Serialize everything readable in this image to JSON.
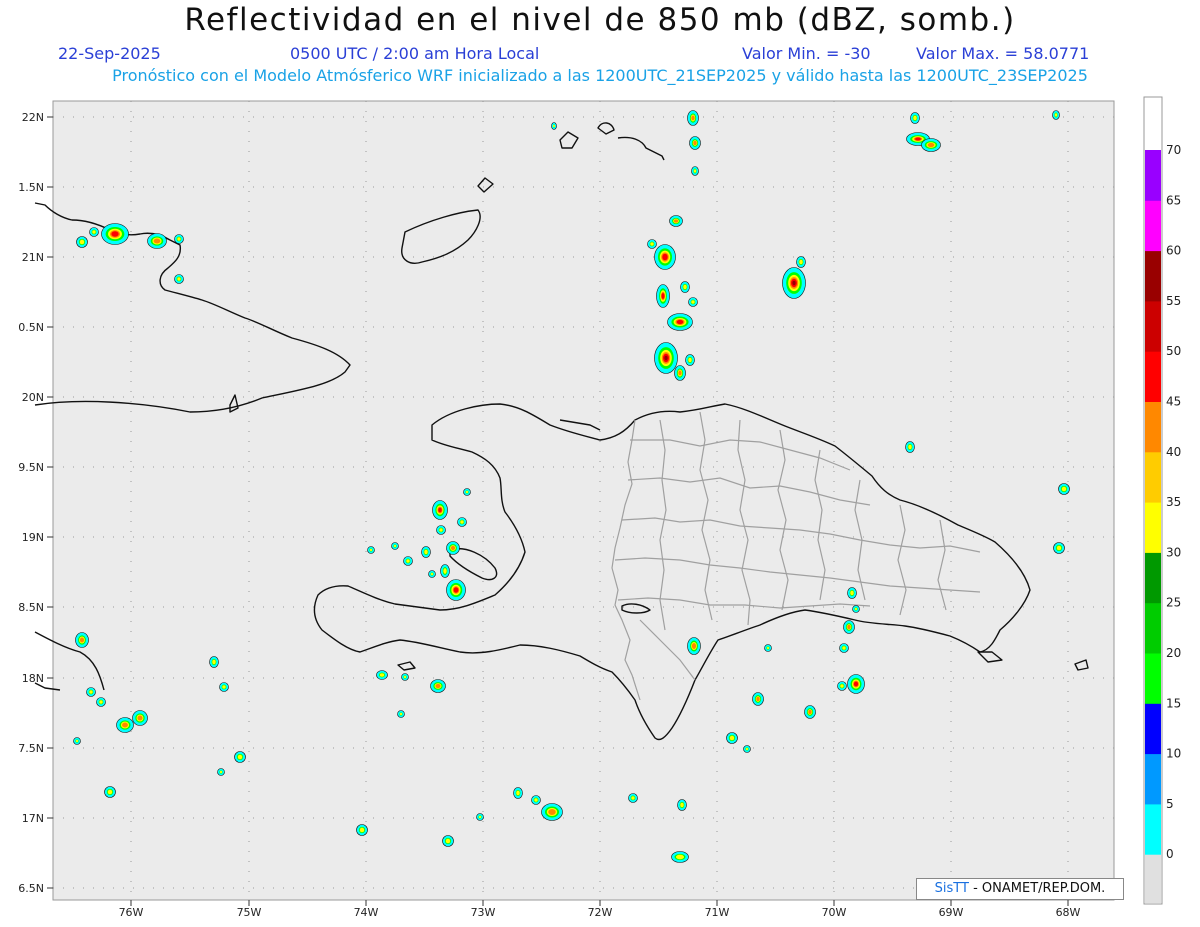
{
  "header": {
    "title": "Reflectividad en el nivel de 850 mb (dBZ, somb.)",
    "date": "22-Sep-2025",
    "time": "0500 UTC / 2:00 am Hora Local",
    "valmin": "Valor Min. = -30",
    "valmax": "Valor Max. = 58.0771",
    "subtitle": "Pronóstico con el Modelo Atmósferico WRF inicializado a las 1200UTC_21SEP2025 y válido hasta las  1200UTC_23SEP2025"
  },
  "axes": {
    "lat_labels": [
      "22N",
      "1.5N",
      "21N",
      "0.5N",
      "20N",
      "9.5N",
      "19N",
      "8.5N",
      "18N",
      "7.5N",
      "17N",
      "6.5N"
    ],
    "lon_labels": [
      "76W",
      "75W",
      "74W",
      "73W",
      "72W",
      "71W",
      "70W",
      "69W",
      "68W"
    ]
  },
  "colorbar": {
    "ticks": [
      "0",
      "5",
      "10",
      "15",
      "20",
      "25",
      "30",
      "35",
      "40",
      "45",
      "50",
      "55",
      "60",
      "65",
      "70"
    ],
    "colors": [
      "#00ffff",
      "#0099ff",
      "#0000ff",
      "#00ff00",
      "#00cc00",
      "#009900",
      "#ffff00",
      "#ffcc00",
      "#ff8800",
      "#ff0000",
      "#cc0000",
      "#990000",
      "#ff00ff",
      "#9900ff"
    ]
  },
  "credit": {
    "brand": "SisTT",
    "text": " - ONAMET/REP.DOM."
  }
}
